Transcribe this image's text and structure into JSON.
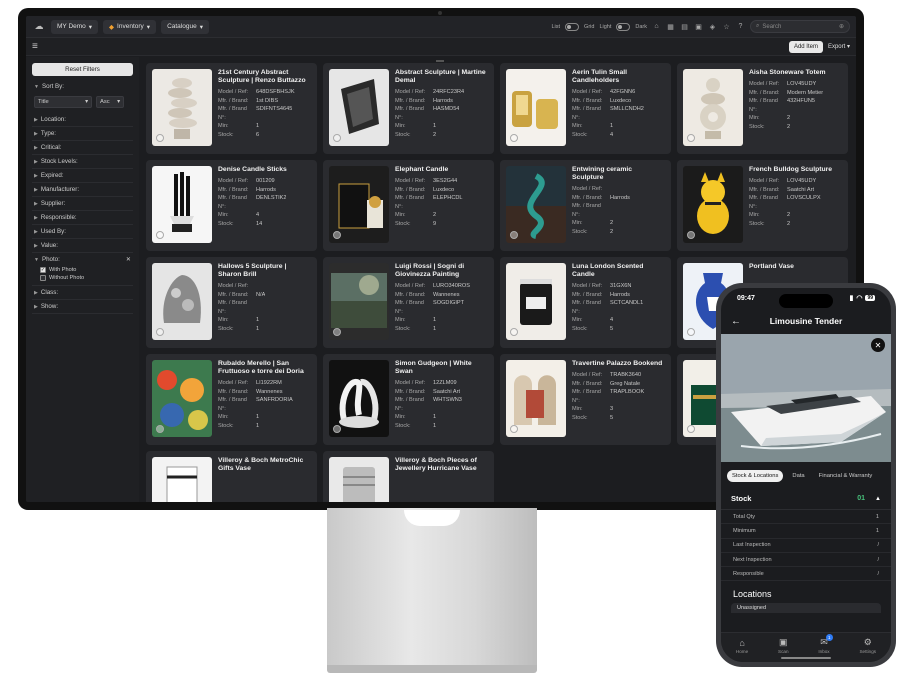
{
  "topbar": {
    "org": "MY Demo",
    "module": "Inventory",
    "view": "Catalogue",
    "toggles": [
      "List",
      "Grid",
      "Light",
      "Dark"
    ],
    "search_placeholder": "Search"
  },
  "toolbar": {
    "add_label": "Add Item",
    "export_label": "Export"
  },
  "sidebar": {
    "reset_label": "Reset Filters",
    "sort_label": "Sort By:",
    "sort_field": "Title",
    "sort_order": "Asc",
    "filters_a": [
      "Location:",
      "Type:",
      "Critical:",
      "Stock Levels:",
      "Expired:",
      "Manufacturer:",
      "Supplier:",
      "Responsible:",
      "Used By:",
      "Value:"
    ],
    "photo_label": "Photo:",
    "photo_options": [
      {
        "label": "With Photo",
        "checked": true
      },
      {
        "label": "Without Photo",
        "checked": false
      }
    ],
    "filters_b": [
      "Class:",
      "Show:"
    ]
  },
  "field_labels": {
    "model": "Model / Ref:",
    "mfr": "Mfr. / Brand:",
    "mfr_no": "Mfr. / Brand N°:",
    "min": "Min:",
    "stock": "Stock:"
  },
  "items": [
    {
      "title": "21st Century Abstract Sculpture | Renzo Buttazzo",
      "model": "648DSFBHSJK",
      "mfr": "1st DIBS",
      "mfr_no": "SDIFNTS4645",
      "min": "1",
      "stock": "6",
      "art": "stack"
    },
    {
      "title": "Abstract Sculpture | Martine Demal",
      "model": "24RFC23R4",
      "mfr": "Harrods",
      "mfr_no": "HASMD54",
      "min": "1",
      "stock": "2",
      "art": "dark"
    },
    {
      "title": "Aerin Tulin Small Candleholders",
      "model": "42FGNN6",
      "mfr": "Luxdeco",
      "mfr_no": "SMLLCNDH2",
      "min": "1",
      "stock": "4",
      "art": "gold"
    },
    {
      "title": "Aisha Stoneware Totem",
      "model": "LOV45UDY",
      "mfr": "Modern Metier",
      "mfr_no": "432HFUN5",
      "min": "2",
      "stock": "2",
      "art": "totem"
    },
    {
      "title": "Denise Candle Sticks",
      "model": "001209",
      "mfr": "Harrods",
      "mfr_no": "DENLSTIK2",
      "min": "4",
      "stock": "14",
      "art": "candles"
    },
    {
      "title": "Elephant Candle",
      "model": "3ES2G44",
      "mfr": "Luxdeco",
      "mfr_no": "ELEPHCDL",
      "min": "2",
      "stock": "9",
      "art": "box"
    },
    {
      "title": "Entwining ceramic Sculpture",
      "model": "",
      "mfr": "Harrods",
      "mfr_no": "",
      "min": "2",
      "stock": "2",
      "art": "teal"
    },
    {
      "title": "French Bulldog Sculpture",
      "model": "LOV45UDY",
      "mfr": "Saatchi Art",
      "mfr_no": "LOVSCULPX",
      "min": "2",
      "stock": "2",
      "art": "yellow"
    },
    {
      "title": "Hallows 5 Sculpture | Sharon Brill",
      "model": "",
      "mfr": "N/A",
      "mfr_no": "",
      "min": "1",
      "stock": "1",
      "art": "grey"
    },
    {
      "title": "Luigi Rossi | Sogni di Giovinezza Painting",
      "model": "LURO340ROS",
      "mfr": "Wannenes",
      "mfr_no": "SOGDIGIPT",
      "min": "1",
      "stock": "1",
      "art": "painting"
    },
    {
      "title": "Luna London Scented Candle",
      "model": "31GX6N",
      "mfr": "Harrods",
      "mfr_no": "SCTCANDL1",
      "min": "4",
      "stock": "5",
      "art": "jar"
    },
    {
      "title": "Portland Vase",
      "model": "",
      "mfr": "",
      "mfr_no": "",
      "min": "",
      "stock": "",
      "art": "blue"
    },
    {
      "title": "Rubaldo Merello | San Fruttuoso e torre dei Doria Painting",
      "model": "LI1922RM",
      "mfr": "Wannenes",
      "mfr_no": "SANFRDORIA",
      "min": "1",
      "stock": "1",
      "art": "colorful"
    },
    {
      "title": "Simon Gudgeon | White Swan",
      "model": "12ZLM09",
      "mfr": "Saatchi Art",
      "mfr_no": "WHTSWN3",
      "min": "1",
      "stock": "1",
      "art": "swan"
    },
    {
      "title": "Travertine Palazzo Bookend",
      "model": "TRABK3640",
      "mfr": "Greg Natale",
      "mfr_no": "TRAPLBOOK",
      "min": "3",
      "stock": "5",
      "art": "stone"
    },
    {
      "title": "",
      "model": "",
      "mfr": "",
      "mfr_no": "",
      "min": "",
      "stock": "",
      "art": "greenbox"
    },
    {
      "title": "Villeroy & Boch MetroChic Gifts Vase",
      "model": "",
      "mfr": "",
      "mfr_no": "",
      "min": "",
      "stock": "",
      "art": "vase"
    },
    {
      "title": "Villeroy & Boch Pieces of Jewellery Hurricane Vase",
      "model": "",
      "mfr": "",
      "mfr_no": "",
      "min": "",
      "stock": "",
      "art": "glass"
    }
  ],
  "phone": {
    "time": "09:47",
    "battery": "99",
    "title": "Limousine Tender",
    "tabs": [
      "Stock & Locations",
      "Data",
      "Financial & Warranty"
    ],
    "stock_label": "Stock",
    "stock_count": "01",
    "rows": [
      {
        "label": "Total Qty",
        "value": "1"
      },
      {
        "label": "Minimum",
        "value": "1"
      },
      {
        "label": "Last Inspection",
        "value": "/"
      },
      {
        "label": "Next Inspection",
        "value": "/"
      },
      {
        "label": "Responsible",
        "value": "/"
      }
    ],
    "locations_label": "Locations",
    "unassigned": "Unassigned",
    "nav": [
      {
        "label": "Home",
        "icon": "home-icon"
      },
      {
        "label": "Scan",
        "icon": "qr-icon"
      },
      {
        "label": "Inbox",
        "icon": "inbox-icon",
        "badge": "1"
      },
      {
        "label": "Settings",
        "icon": "gear-icon"
      }
    ]
  },
  "colors": {
    "bg": "#1c1d20",
    "card": "#2a2b2f",
    "accent_green": "#47c07b",
    "badge_blue": "#2f7cf6"
  }
}
